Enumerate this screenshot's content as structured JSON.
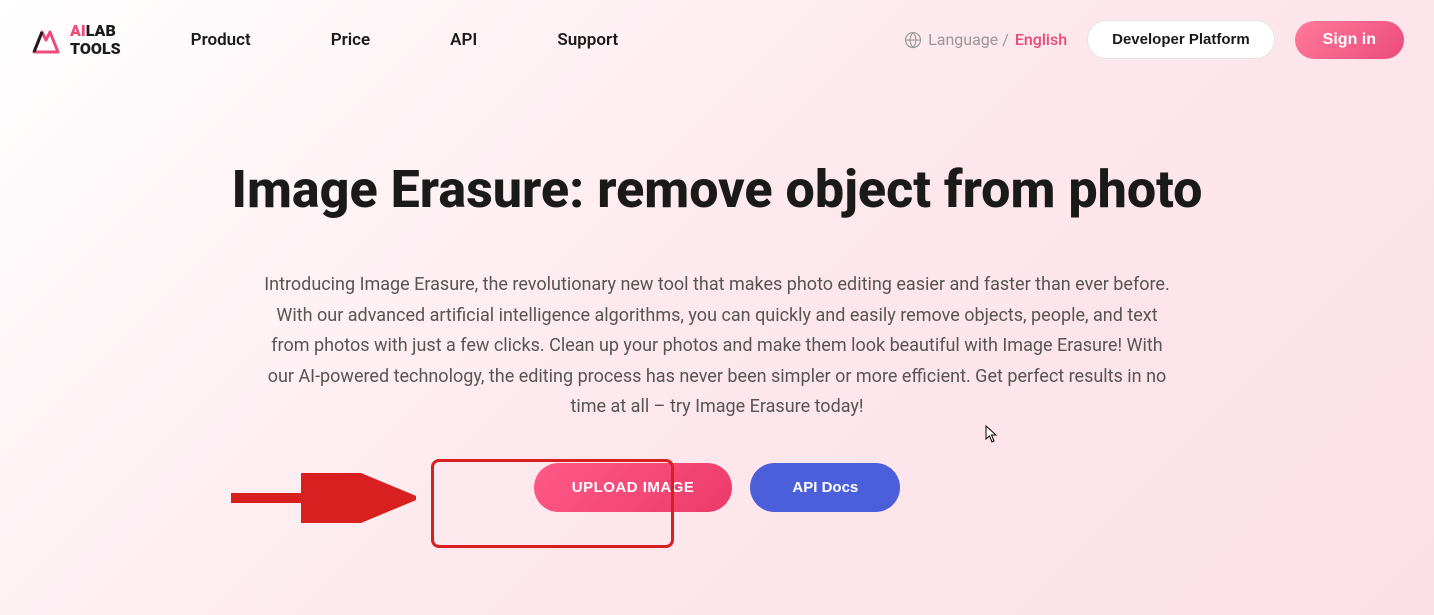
{
  "logo": {
    "ai": "AI",
    "lab": "LAB",
    "tools": "TOOLS"
  },
  "nav": {
    "product": "Product",
    "price": "Price",
    "api": "API",
    "support": "Support"
  },
  "language": {
    "label": "Language /",
    "selected": "English"
  },
  "devPlatform": "Developer Platform",
  "signIn": "Sign in",
  "hero": {
    "title": "Image Erasure: remove object from photo",
    "description": "Introducing Image Erasure, the revolutionary new tool that makes photo editing easier and faster than ever before. With our advanced artificial intelligence algorithms, you can quickly and easily remove objects, people, and text from photos with just a few clicks. Clean up your photos and make them look beautiful with Image Erasure! With our AI-powered technology, the editing process has never been simpler or more efficient. Get perfect results in no time at all – try Image Erasure today!"
  },
  "buttons": {
    "upload": "UPLOAD IMAGE",
    "apiDocs": "API Docs"
  }
}
